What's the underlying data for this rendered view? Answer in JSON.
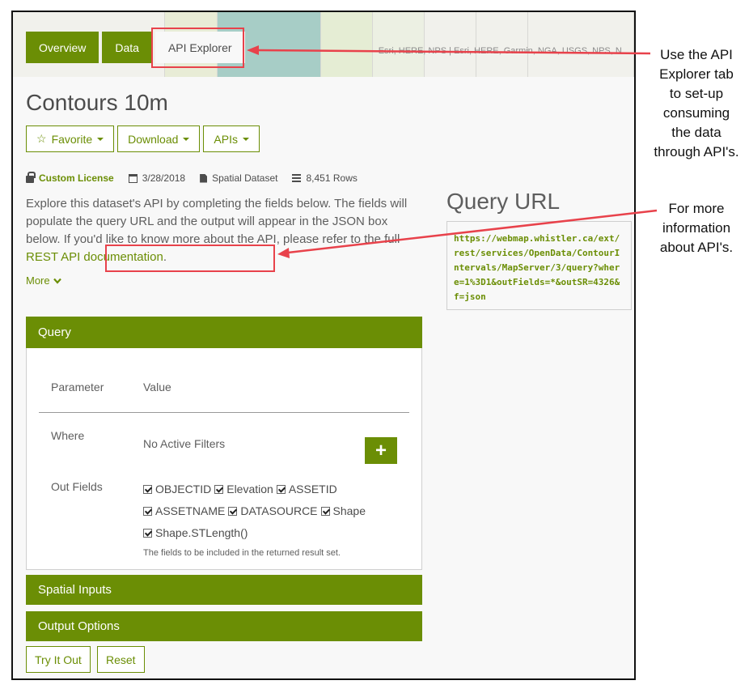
{
  "map": {
    "attribution": "Esri, HERE, NPS | Esri, HERE, Garmin, NGA, USGS, NPS, N..."
  },
  "tabs": [
    {
      "label": "Overview",
      "active": false
    },
    {
      "label": "Data",
      "active": false
    },
    {
      "label": "API Explorer",
      "active": true
    }
  ],
  "page_title": "Contours 10m",
  "buttons": {
    "favorite": "Favorite",
    "download": "Download",
    "apis": "APIs",
    "try_it_out": "Try It Out",
    "reset": "Reset"
  },
  "meta": {
    "license": "Custom License",
    "date": "3/28/2018",
    "type": "Spatial Dataset",
    "rows": "8,451 Rows"
  },
  "description": {
    "text": "Explore this dataset's API by completing the fields below. The fields will populate the query URL and the output will appear in the JSON box below. If you'd like to know more about the API, please refer to the full ",
    "link": "REST API documentation",
    "end": ".",
    "more": "More"
  },
  "query_url": {
    "title": "Query URL",
    "url": "https://webmap.whistler.ca/ext/rest/services/OpenData/ContourIntervals/MapServer/3/query?where=1%3D1&outFields=*&outSR=4326&f=json"
  },
  "query_panel": {
    "title": "Query",
    "header_param": "Parameter",
    "header_value": "Value",
    "where_label": "Where",
    "where_value": "No Active Filters",
    "add_label": "+",
    "out_fields_label": "Out Fields",
    "fields": [
      "OBJECTID",
      "Elevation",
      "ASSETID",
      "ASSETNAME",
      "DATASOURCE",
      "Shape",
      "Shape.STLength()"
    ],
    "help": "The fields to be included in the returned result set."
  },
  "panels": {
    "spatial_inputs": "Spatial Inputs",
    "output_options": "Output Options"
  },
  "annotations": {
    "note1": [
      "Use the API",
      "Explorer tab",
      "to set-up",
      "consuming",
      "the data",
      "through API's."
    ],
    "note2": [
      "For more",
      "information",
      "about API's."
    ]
  },
  "colors": {
    "accent": "#6b8e05",
    "highlight": "#e8424b"
  }
}
